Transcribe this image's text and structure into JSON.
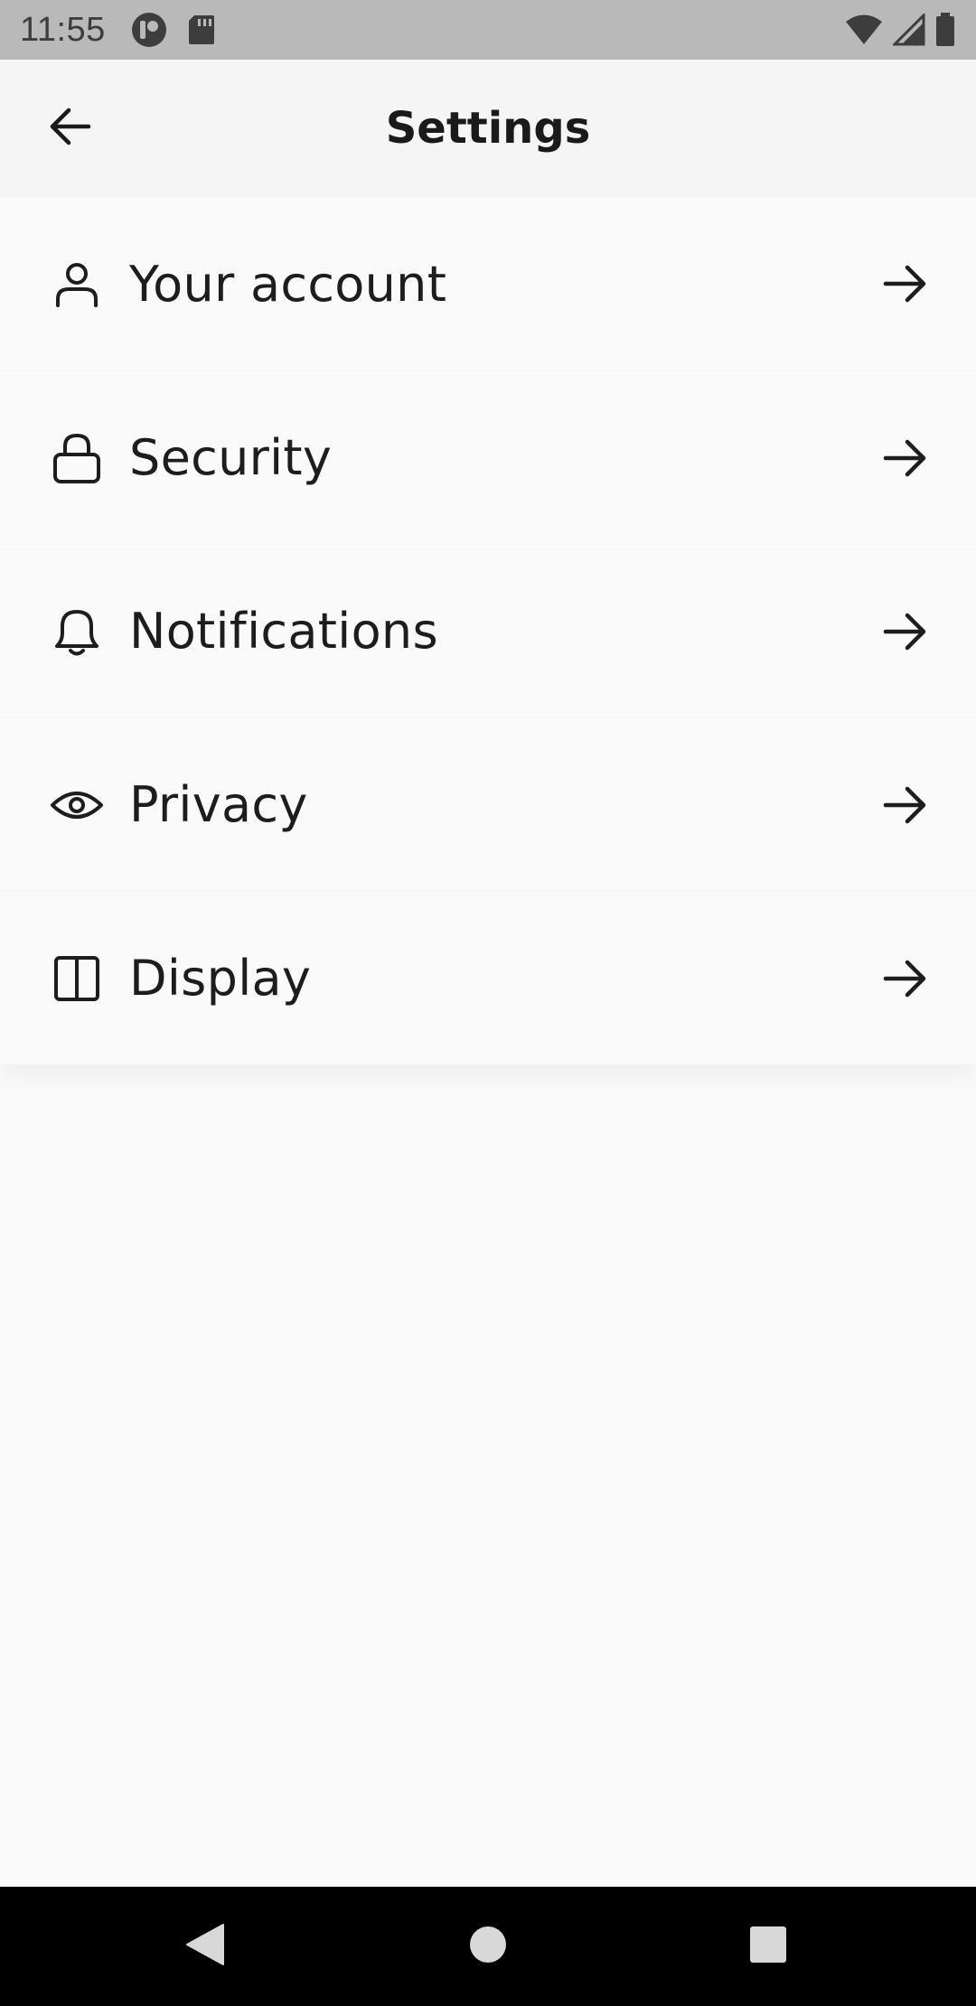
{
  "status_bar": {
    "time": "11:55",
    "icons": [
      "app-notification-icon",
      "sd-card-icon",
      "wifi-icon",
      "cellular-signal-icon",
      "battery-icon"
    ]
  },
  "app_bar": {
    "title": "Settings",
    "back_icon": "arrow-left-icon"
  },
  "settings": {
    "items": [
      {
        "label": "Your account",
        "icon": "person-icon"
      },
      {
        "label": "Security",
        "icon": "lock-icon"
      },
      {
        "label": "Notifications",
        "icon": "bell-icon"
      },
      {
        "label": "Privacy",
        "icon": "eye-icon"
      },
      {
        "label": "Display",
        "icon": "display-layout-icon"
      }
    ],
    "chevron_icon": "arrow-right-icon"
  },
  "nav_bar": {
    "buttons": [
      "back-triangle-icon",
      "home-circle-icon",
      "recents-square-icon"
    ]
  },
  "colors": {
    "status_bar_bg": "#b9b9b9",
    "app_bar_bg": "#f5f5f5",
    "page_bg": "#fafafa",
    "text": "#1d1d1d",
    "nav_bar_bg": "#000000"
  }
}
